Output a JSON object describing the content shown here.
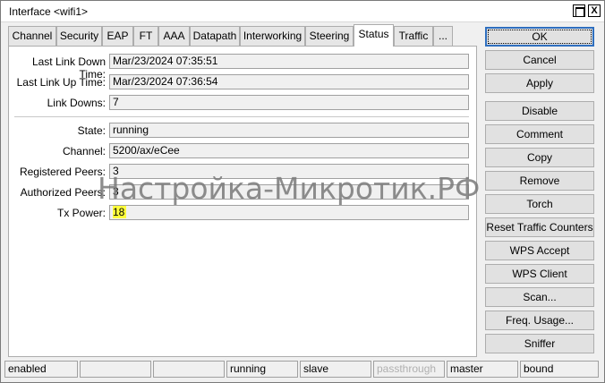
{
  "window": {
    "title": "Interface <wifi1>",
    "maximize_label": "",
    "close_label": "X"
  },
  "tabs": [
    {
      "label": "Channel"
    },
    {
      "label": "Security"
    },
    {
      "label": "EAP"
    },
    {
      "label": "FT"
    },
    {
      "label": "AAA"
    },
    {
      "label": "Datapath"
    },
    {
      "label": "Interworking"
    },
    {
      "label": "Steering"
    },
    {
      "label": "Status",
      "active": true
    },
    {
      "label": "Traffic"
    },
    {
      "label": "..."
    }
  ],
  "status": {
    "last_link_down_time": {
      "label": "Last Link Down Time:",
      "value": "Mar/23/2024 07:35:51"
    },
    "last_link_up_time": {
      "label": "Last Link Up Time:",
      "value": "Mar/23/2024 07:36:54"
    },
    "link_downs": {
      "label": "Link Downs:",
      "value": "7"
    },
    "state": {
      "label": "State:",
      "value": "running"
    },
    "channel": {
      "label": "Channel:",
      "value": "5200/ax/eCee"
    },
    "registered_peers": {
      "label": "Registered Peers:",
      "value": "3"
    },
    "authorized_peers": {
      "label": "Authorized Peers:",
      "value": "3"
    },
    "tx_power": {
      "label": "Tx Power:",
      "value": "18"
    }
  },
  "buttons": {
    "ok": "OK",
    "cancel": "Cancel",
    "apply": "Apply",
    "disable": "Disable",
    "comment": "Comment",
    "copy": "Copy",
    "remove": "Remove",
    "torch": "Torch",
    "reset_traffic_counters": "Reset Traffic Counters",
    "wps_accept": "WPS Accept",
    "wps_client": "WPS Client",
    "scan": "Scan...",
    "freq_usage": "Freq. Usage...",
    "sniffer": "Sniffer"
  },
  "statusbar": [
    "enabled",
    "",
    "",
    "running",
    "slave",
    "passthrough",
    "master",
    "bound"
  ],
  "watermark": "Настройка-Микротик.РФ",
  "colors": {
    "highlight": "#ffff3a",
    "default_button_border": "#2f6fbf",
    "disabled_text": "#b0b0b0"
  }
}
